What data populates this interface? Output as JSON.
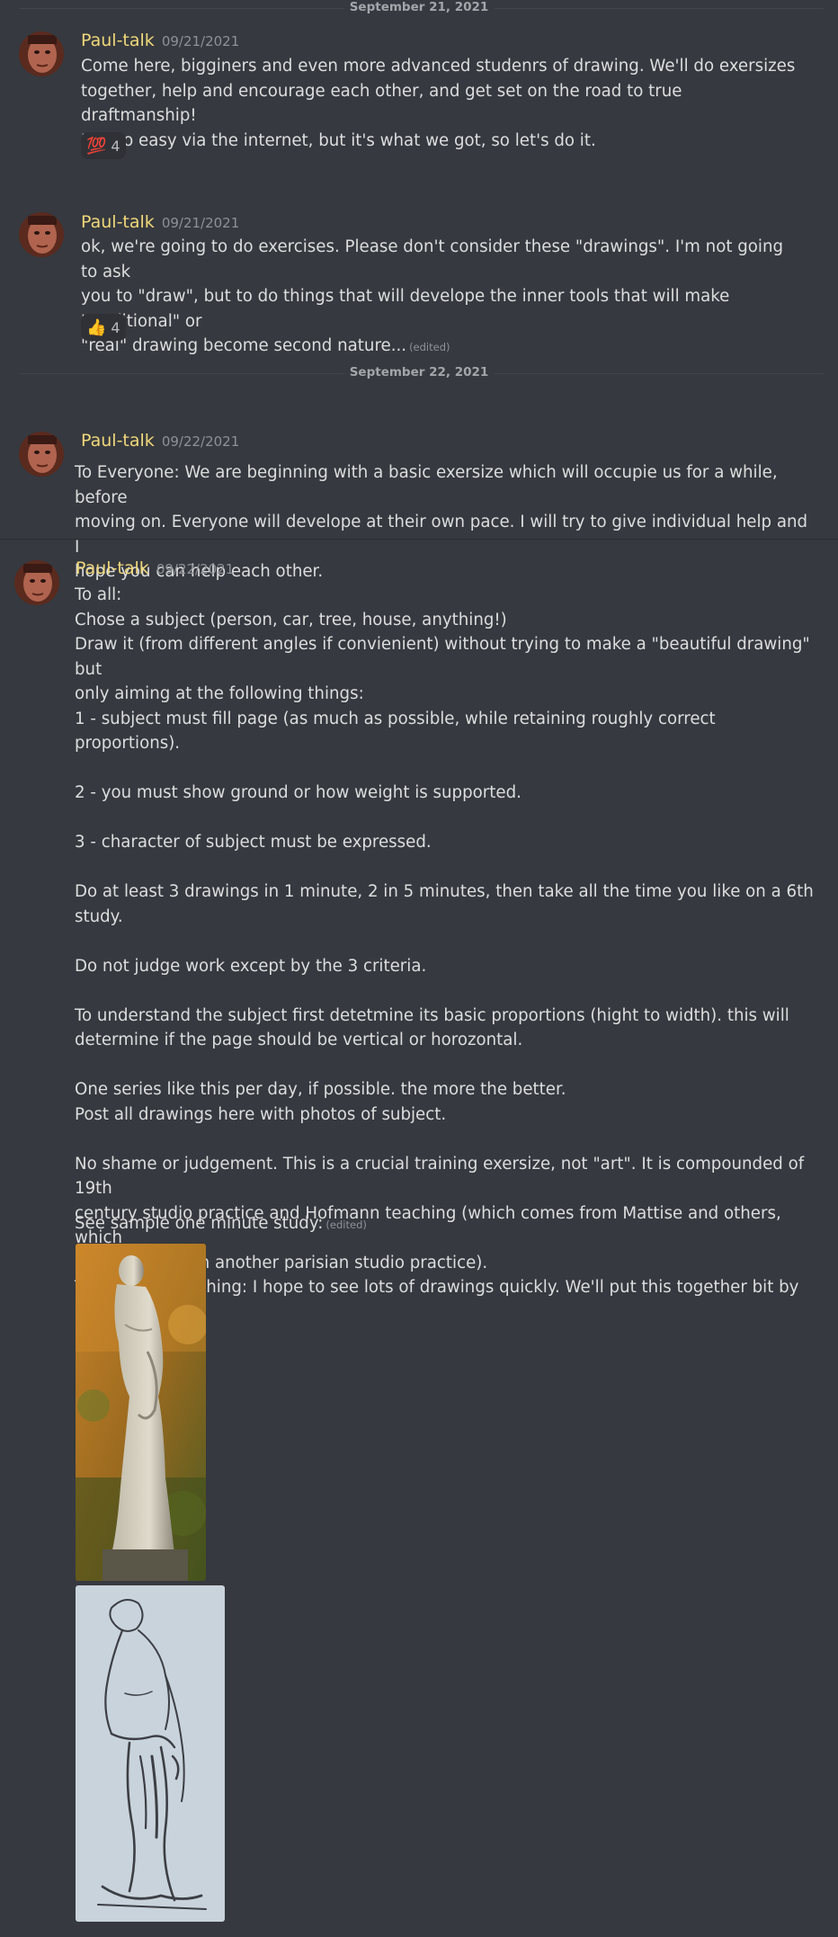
{
  "dividers": [
    {
      "label": "September 21, 2021"
    },
    {
      "label": "September 22, 2021"
    }
  ],
  "messages": [
    {
      "author": "Paul-talk",
      "timestamp": "09/21/2021",
      "lines": [
        "Come here, bigginers and even more advanced studenrs of drawing. We'll do exersizes",
        "together, help and encourage each other, and get set on the road to true draftmanship!",
        "Not so easy via the internet, but it's what we got, so let's do it."
      ],
      "reaction": {
        "emoji": "💯",
        "icon": "hundred-points-icon",
        "count": "4"
      }
    },
    {
      "author": "Paul-talk",
      "timestamp": "09/21/2021",
      "lines": [
        "ok, we're going to do exercises. Please don't consider these \"drawings\". I'm not going to ask",
        "you to \"draw\", but to do things that will develope the inner tools that will make \"traditional\" or",
        "\"real\" drawing become second nature..."
      ],
      "edited": "(edited)",
      "reaction": {
        "emoji": "👍",
        "icon": "thumbs-up-icon",
        "count": "4"
      }
    },
    {
      "author": "Paul-talk",
      "timestamp": "09/22/2021",
      "lines": [
        "To Everyone: We are beginning with a basic exersize which will occupie us for a while, before",
        "moving on. Everyone will develope at their own pace. I will try to give individual help and I",
        "hope you can help each other."
      ]
    },
    {
      "author": "Paul-talk",
      "timestamp": "09/22/2021",
      "lines": [
        "To all:",
        "Chose a subject (person, car, tree, house, anything!)",
        "Draw it (from different angles if convienient) without trying to make a \"beautiful drawing\" but",
        "only aiming at the following things:",
        "",
        "1 - subject must fill page (as much as possible, while retaining roughly correct proportions).",
        "",
        "2 - you must show ground or how weight is supported.",
        "",
        "3 - character of subject must be expressed.",
        "",
        "Do at least 3 drawings in 1 minute, 2 in 5 minutes, then take all the time you like on a 6th study.",
        "",
        "Do not judge work except by the 3 criteria.",
        "",
        "To understand the subject first detetmine its basic proportions (hight to width). this will",
        "determine if the page should be vertical or horozontal.",
        "",
        "One series like this per day, if possible. the more the better.",
        "Post all drawings here with photos of subject.",
        "",
        "No shame or judgement. This is a crucial training exersize, not \"art\". It is compounded of 19th",
        "century studio practice and Hofmann teaching (which comes from Mattise and others, which",
        "also comes from another parisian studio practice).",
        "This is the real thing: I hope to see lots of drawings quickly. We'll put this together bit by bit..."
      ],
      "followup": "See sample one minute study:",
      "followup_edited": "(edited)"
    }
  ],
  "colors": {
    "background": "#36393f",
    "author": "#f0d87a",
    "text": "#dcddde",
    "muted": "#8e9297",
    "reaction_bg": "#2f3136"
  }
}
